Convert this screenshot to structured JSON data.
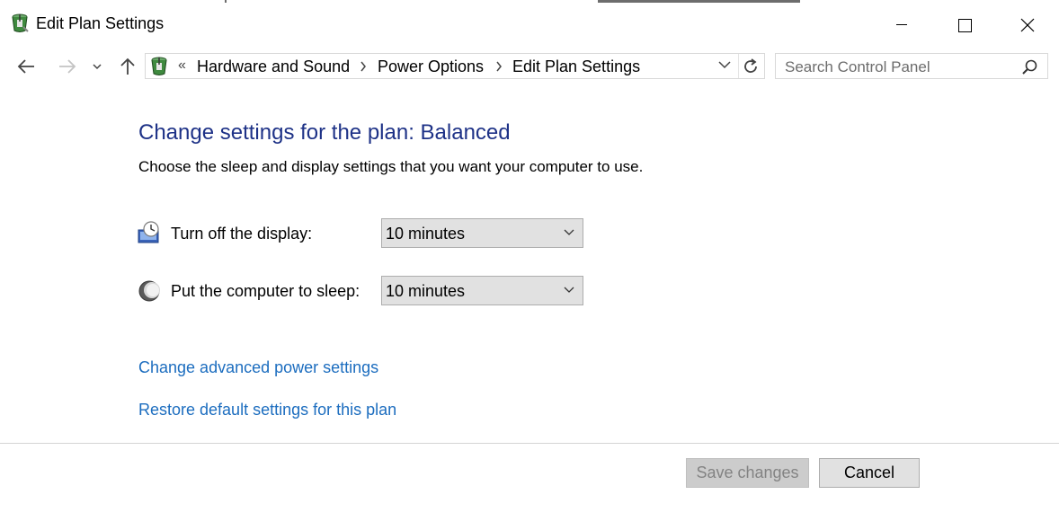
{
  "window": {
    "title": "Edit Plan Settings",
    "app_icon": "control-panel-power-icon",
    "controls": {
      "minimize": "minimize-icon",
      "maximize": "maximize-icon",
      "close": "close-icon"
    }
  },
  "nav": {
    "back": "back-arrow-icon",
    "forward": "forward-arrow-icon",
    "recent": "chevron-down-icon",
    "up": "up-arrow-icon"
  },
  "address": {
    "overflow": "«",
    "breadcrumbs": [
      "Hardware and Sound",
      "Power Options",
      "Edit Plan Settings"
    ],
    "refresh": "refresh-icon"
  },
  "search": {
    "placeholder": "Search Control Panel",
    "icon": "search-icon"
  },
  "main": {
    "heading": "Change settings for the plan: Balanced",
    "description": "Choose the sleep and display settings that you want your computer to use.",
    "settings": [
      {
        "label": "Turn off the display:",
        "value": "10 minutes",
        "icon": "display-clock-icon"
      },
      {
        "label": "Put the computer to sleep:",
        "value": "10 minutes",
        "icon": "moon-sleep-icon"
      }
    ],
    "links": [
      "Change advanced power settings",
      "Restore default settings for this plan"
    ]
  },
  "footer": {
    "save_label": "Save changes",
    "cancel_label": "Cancel"
  },
  "colors": {
    "heading": "#1e3287",
    "link": "#1c6dbf",
    "button_disabled_bg": "#cccccc",
    "button_bg": "#e1e1e1"
  }
}
